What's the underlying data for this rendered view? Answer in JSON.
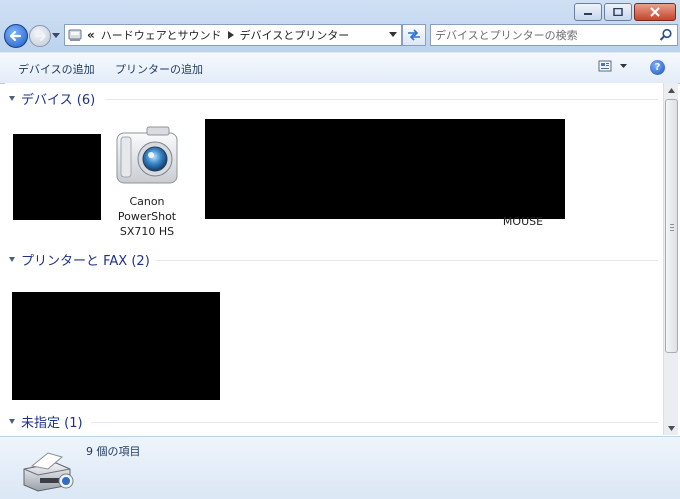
{
  "address": {
    "crumb_prefix": "«",
    "crumbs": [
      "ハードウェアとサウンド",
      "デバイスとプリンター"
    ]
  },
  "search": {
    "placeholder": "デバイスとプリンターの検索"
  },
  "toolbar": {
    "add_device_label": "デバイスの追加",
    "add_printer_label": "プリンターの追加"
  },
  "groups": {
    "devices": {
      "title": "デバイス (6)"
    },
    "printers": {
      "title": "プリンターと FAX (2)"
    },
    "unspecified": {
      "title": "未指定 (1)"
    }
  },
  "devices": {
    "camera": {
      "label_line1": "Canon",
      "label_line2": "PowerShot",
      "label_line3": "SX710 HS"
    },
    "mouse": {
      "label": "MOUSE"
    }
  },
  "details": {
    "count_text": "9 個の項目"
  },
  "colors": {
    "group_title": "#1e3287",
    "accent": "#1e5bc6",
    "redaction": "#000000"
  },
  "icons": {
    "back": "back-arrow-icon",
    "forward": "forward-arrow-icon",
    "search": "search-icon",
    "refresh": "refresh-icon",
    "help": "help-icon",
    "camera": "camera-icon",
    "printer": "printer-icon"
  }
}
